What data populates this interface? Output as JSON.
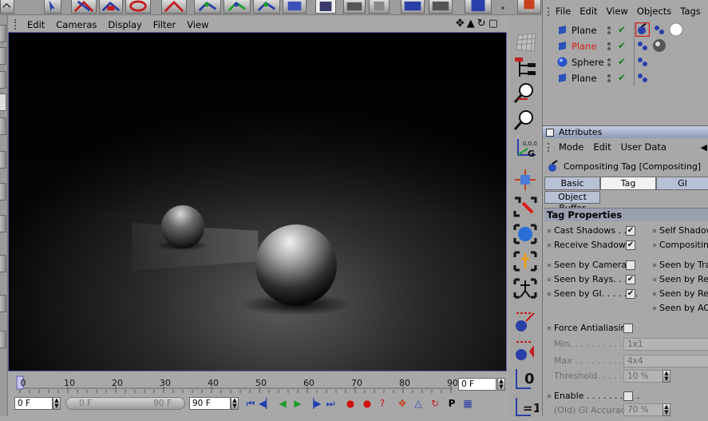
{
  "viewport_menu": [
    "Edit",
    "Cameras",
    "Display",
    "Filter",
    "View"
  ],
  "object_manager": {
    "menu": [
      "File",
      "Edit",
      "View",
      "Objects",
      "Tags"
    ],
    "objects": [
      {
        "name": "Plane",
        "color": "#000000",
        "icon": "plane-icon"
      },
      {
        "name": "Plane",
        "color": "#d0201a",
        "icon": "plane-icon"
      },
      {
        "name": "Sphere",
        "color": "#000000",
        "icon": "sphere-icon"
      },
      {
        "name": "Plane",
        "color": "#000000",
        "icon": "plane-icon"
      }
    ]
  },
  "attributes": {
    "title": "Attributes",
    "menu": [
      "Mode",
      "Edit",
      "User Data"
    ],
    "header": "Compositing Tag [Compositing]",
    "tabs": [
      "Basic",
      "Tag",
      "GI"
    ],
    "active_tab": "Tag",
    "tab_extra": "Object Buffer",
    "section": "Tag Properties",
    "props_left": [
      {
        "label": "Cast Shadows . . .",
        "checked": true
      },
      {
        "label": "Receive Shadows",
        "checked": true
      },
      {
        "label": "Seen by Camera",
        "checked": false
      },
      {
        "label": "Seen by Rays. . . .",
        "checked": true
      },
      {
        "label": "Seen by GI. . . . . . .",
        "checked": true
      },
      {
        "label": "Force Antialiasing",
        "checked": false
      }
    ],
    "props_right": [
      "Self Shadowi",
      "Compositing B",
      "Seen by Tran",
      "Seen by Refr",
      "Seen by Refl",
      "Seen by AO ."
    ],
    "aa": {
      "min_label": "Min. . . . . . . . . . . .",
      "min_value": "1x1",
      "max_label": "Max . . . . . . . . . . .",
      "max_value": "4x4",
      "threshold_label": "Threshold. . . . . . .",
      "threshold_value": "10 %"
    },
    "enable_label": "Enable . . . . . . . . . .",
    "enable_checked": false,
    "gi_accuracy_label": "(Old) GI Accuracy",
    "gi_accuracy_value": "70 %"
  },
  "timeline": {
    "ticks": [
      "0",
      "10",
      "20",
      "30",
      "40",
      "50",
      "60",
      "70",
      "80",
      "90"
    ],
    "current_frame": "0 F",
    "start_frame": "0 F",
    "range_start": "0 F",
    "range_end": "90 F",
    "end_frame": "90 F"
  }
}
